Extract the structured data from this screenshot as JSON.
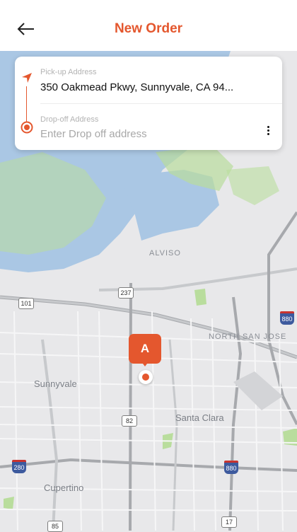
{
  "header": {
    "title": "New Order",
    "back_icon": "arrow-left-icon"
  },
  "addresses": {
    "pickup_label": "Pick-up Address",
    "pickup_value": "350 Oakmead Pkwy, Sunnyvale, CA 94...",
    "dropoff_label": "Drop-off Address",
    "dropoff_placeholder": "Enter Drop off address",
    "more_icon": "more-vertical-icon",
    "pickup_icon": "navigation-arrow-icon",
    "dropoff_icon": "target-icon"
  },
  "map": {
    "marker_label": "A",
    "places": [
      "ALVISO",
      "NORTH SAN JOSE",
      "Sunnyvale",
      "Santa Clara",
      "Cupertino"
    ],
    "routes": [
      "101",
      "237",
      "82",
      "85",
      "17"
    ],
    "interstates": [
      "880",
      "280",
      "880"
    ]
  },
  "colors": {
    "accent": "#e4572e",
    "water": "#aac7e4",
    "park": "#b9dd9d",
    "land": "#e8e8ea"
  }
}
